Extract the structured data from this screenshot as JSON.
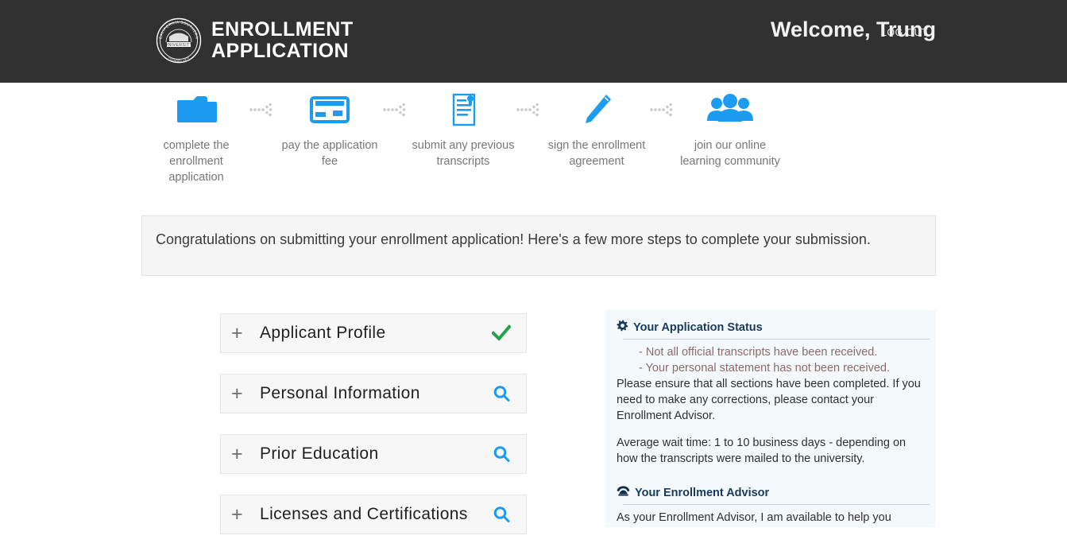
{
  "header": {
    "logo_name": "california-southern-university-seal",
    "logo_text_outer": "CALIFORNIA SOUTHERN",
    "logo_text_inner": "UNIVERSITY",
    "title_line1": "ENROLLMENT",
    "title_line2": "APPLICATION",
    "welcome": "Welcome, Trung",
    "logout_label": "LOG OUT",
    "bg_color": "#313131"
  },
  "steps": [
    {
      "icon": "folder-icon",
      "label": "complete the enrollment application"
    },
    {
      "icon": "credit-card-icon",
      "label": "pay the application fee"
    },
    {
      "icon": "transcript-icon",
      "label": "submit any previous transcripts"
    },
    {
      "icon": "pen-icon",
      "label": "sign the enrollment agreement"
    },
    {
      "icon": "people-icon",
      "label": "join our online learning community"
    }
  ],
  "steps_accent_color": "#1b9cf0",
  "banner": {
    "text": "Congratulations on submitting your enrollment application! Here's a few more steps to complete your submission."
  },
  "accordion": {
    "items": [
      {
        "expander": "+",
        "label": "Applicant Profile",
        "status_icon": "green-checkmark-icon",
        "status": "complete"
      },
      {
        "expander": "+",
        "label": "Personal Information",
        "status_icon": "magnifier-icon",
        "status": "review"
      },
      {
        "expander": "+",
        "label": "Prior Education",
        "status_icon": "magnifier-icon",
        "status": "review"
      },
      {
        "expander": "+",
        "label": "Licenses and Certifications",
        "status_icon": "magnifier-icon",
        "status": "review"
      }
    ],
    "complete_color": "#22a34a",
    "review_color": "#1b9cf0"
  },
  "side_panel": {
    "status_heading": "Your Application Status",
    "status_icon": "gear-icon",
    "bullets": [
      "- Not all official transcripts have been received.",
      "- Your personal statement has not been received."
    ],
    "status_body": "Please ensure that all sections have been completed. If you need to make any corrections, please contact your Enrollment Advisor.",
    "wait_time": "Average wait time: 1 to 10 business days - depending on how the transcripts were mailed to the university.",
    "advisor_heading": "Your Enrollment Advisor",
    "advisor_icon": "telephone-icon",
    "advisor_body": "As your Enrollment Advisor, I am available to help you",
    "bullet_color": "#8d6a6a",
    "heading_color": "#1a3a5c",
    "bg_color": "#f4f9fb"
  }
}
